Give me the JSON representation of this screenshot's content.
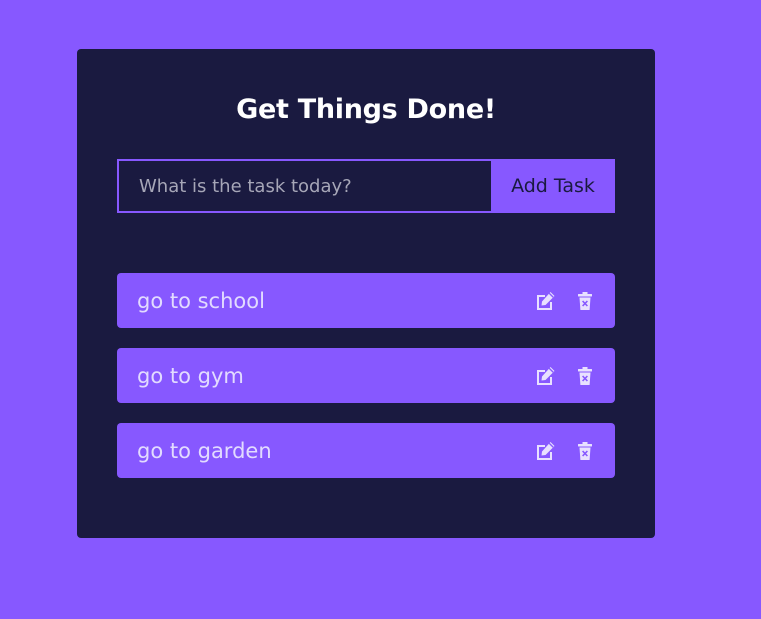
{
  "app": {
    "title": "Get Things Done!"
  },
  "form": {
    "input_value": "",
    "input_placeholder": "What is the task today?",
    "add_label": "Add Task"
  },
  "tasks": [
    {
      "text": "go to school",
      "edit_icon": "edit-icon",
      "delete_icon": "trash-icon"
    },
    {
      "text": "go to gym",
      "edit_icon": "edit-icon",
      "delete_icon": "trash-icon"
    },
    {
      "text": "go to garden",
      "edit_icon": "edit-icon",
      "delete_icon": "trash-icon"
    }
  ],
  "colors": {
    "background": "#8758ff",
    "card": "#1a1a40",
    "accent": "#8758ff",
    "text": "#ffffff"
  }
}
